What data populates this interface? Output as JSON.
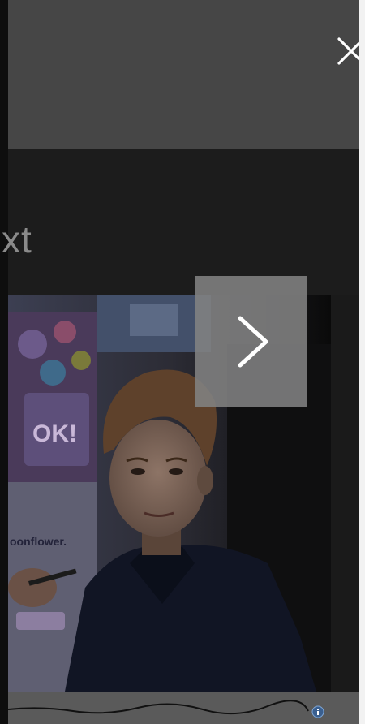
{
  "header": {
    "close_icon": "close-icon"
  },
  "title_fragment": "xt",
  "carousel": {
    "next_icon": "chevron-right-icon",
    "image_sign_text": "oonflower.",
    "image_poster_text": "OK!"
  },
  "footer": {
    "info_icon": "info-icon"
  },
  "colors": {
    "top_bar": "#464646",
    "background": "#1a1a1a",
    "next_button": "#828282"
  }
}
